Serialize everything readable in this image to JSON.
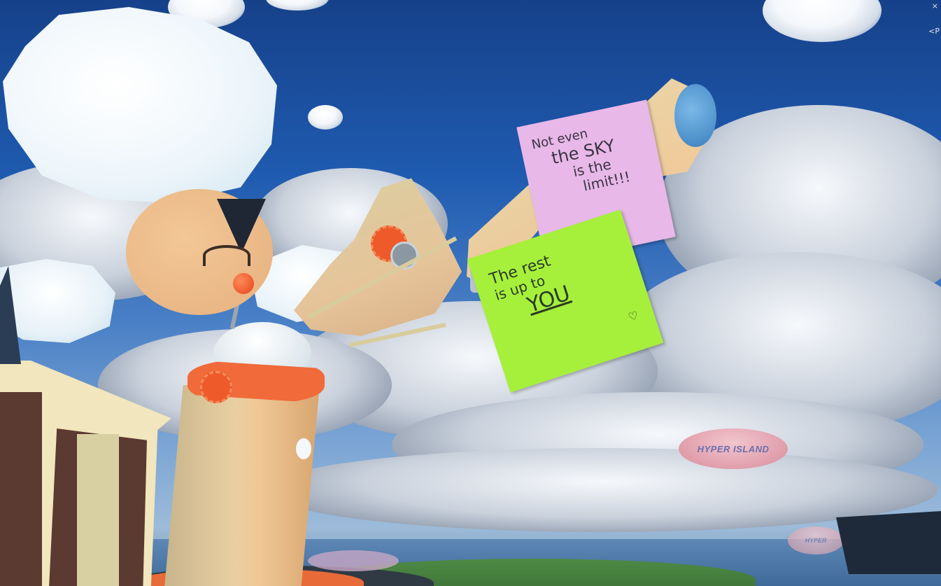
{
  "hud": {
    "close_glyph": "×",
    "partial_label": "<P"
  },
  "notes": {
    "pink": {
      "line1": "Not even",
      "line2": "the SKY",
      "line3": "is the",
      "line4": "limit!!!"
    },
    "green": {
      "line1": "The rest",
      "line2": "is up to",
      "line3": "YOU",
      "heart": "♡"
    }
  },
  "blimp": {
    "label": "HYPER ISLAND",
    "label_small": "HYPER"
  },
  "colors": {
    "sky": "#1f5bb0",
    "pink_note": "#e6b4e6",
    "green_note": "#a4f03c",
    "robot_body": "#e6c79a",
    "robot_accent": "#f0642d",
    "blimp": "#e4a7b3",
    "ground": "#3f7a3a"
  }
}
